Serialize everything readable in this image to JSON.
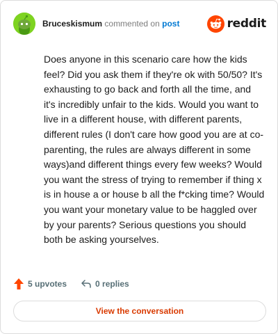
{
  "header": {
    "username": "Bruceskismum",
    "commented_text": "commented on",
    "post_link": "post",
    "brand": "reddit"
  },
  "comment": {
    "body": "Does anyone in this scenario care how the kids feel? Did you ask them if they're ok with 50/50? It's exhausting to go back and forth all the time, and it's incredibly unfair to the kids. Would you want to live in a different house, with different parents, different rules (I don't care how good you are at co-parenting, the rules are always different in some ways)and different things every few weeks? Would you want the stress of trying to remember if thing x is in house a or house b all the f*cking time? Would you want your monetary value to be haggled over by your parents? Serious questions you should both be asking yourselves."
  },
  "actions": {
    "upvotes_label": "5 upvotes",
    "replies_label": "0 replies",
    "upvote_icon": "upvote-arrow-icon",
    "reply_icon": "reply-arrow-icon"
  },
  "cta": {
    "label": "View the conversation"
  },
  "colors": {
    "avatar_bg": "#7ed321",
    "brand": "#ff4500",
    "upvote": "#ff4500",
    "cta_text": "#d93a00",
    "link": "#0079d3"
  }
}
